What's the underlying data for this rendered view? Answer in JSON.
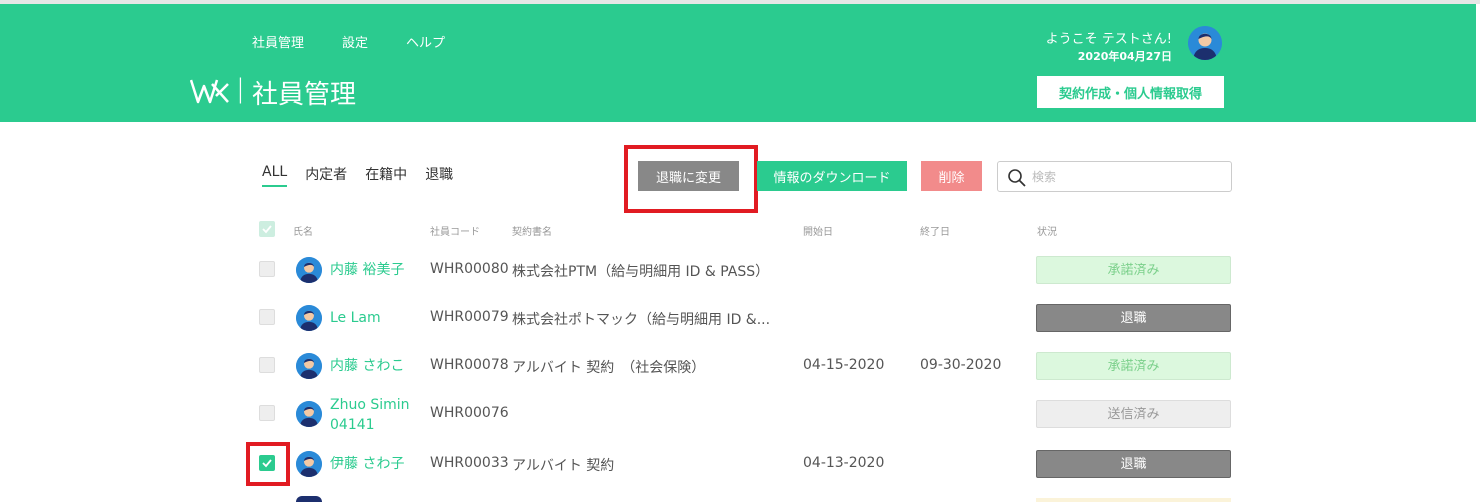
{
  "nav": {
    "items": [
      "社員管理",
      "設定",
      "ヘルプ"
    ]
  },
  "brand": {
    "separator": "|",
    "title": "社員管理",
    "logo_icon": "wx-logo-icon"
  },
  "user": {
    "welcome": "ようこそ テストさん!",
    "date": "2020年04月27日"
  },
  "header": {
    "contract_button": "契約作成・個人情報取得"
  },
  "tabs": [
    "ALL",
    "内定者",
    "在籍中",
    "退職"
  ],
  "toolbar": {
    "retire_button": "退職に変更",
    "download_button": "情報のダウンロード",
    "delete_button": "削除"
  },
  "search": {
    "placeholder": "検索",
    "value": ""
  },
  "table": {
    "headers": [
      "氏名",
      "社員コード",
      "契約書名",
      "開始日",
      "終了日",
      "状況"
    ],
    "rows": [
      {
        "name": "内藤 裕美子",
        "code": "WHR00080",
        "contract": "株式会社PTM（給与明細用 ID & PASS）",
        "start": "",
        "end": "",
        "status": "承諾済み",
        "status_type": "accepted",
        "checked": false
      },
      {
        "name": "Le Lam",
        "code": "WHR00079",
        "contract": "株式会社ポトマック（給与明細用 ID &...",
        "start": "",
        "end": "",
        "status": "退職",
        "status_type": "retired",
        "checked": false
      },
      {
        "name": "内藤 さわこ",
        "code": "WHR00078",
        "contract": "アルバイト 契約　（社会保険）",
        "start": "04-15-2020",
        "end": "09-30-2020",
        "status": "承諾済み",
        "status_type": "accepted",
        "checked": false
      },
      {
        "name": "Zhuo Simin 04141",
        "name_line1": "Zhuo Simin",
        "name_line2": "04141",
        "code": "WHR00076",
        "contract": "",
        "start": "",
        "end": "",
        "status": "送信済み",
        "status_type": "sent",
        "checked": false
      },
      {
        "name": "伊藤 さわ子",
        "code": "WHR00033",
        "contract": "アルバイト 契約",
        "start": "04-13-2020",
        "end": "",
        "status": "退職",
        "status_type": "retired",
        "checked": true
      }
    ]
  },
  "colors": {
    "accent": "#2bcb8f",
    "highlight": "#e11b22",
    "retired": "#888888",
    "accepted_bg": "#dcf8de",
    "delete": "#f28b8b"
  }
}
